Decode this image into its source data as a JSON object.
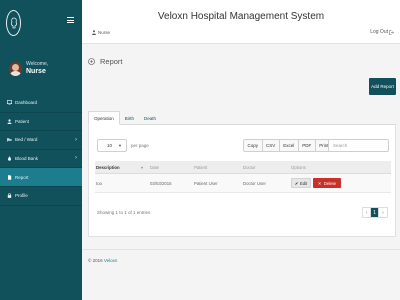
{
  "app": {
    "title": "Veloxn Hospital Management System"
  },
  "sidebar": {
    "profile": {
      "welcome": "Welcome,",
      "name": "Nurse"
    },
    "items": [
      {
        "label": "Dashboard",
        "icon": "dashboard-icon"
      },
      {
        "label": "Patient",
        "icon": "user-icon"
      },
      {
        "label": "Bed / Ward",
        "icon": "bed-icon",
        "has_children": true
      },
      {
        "label": "Blood Bank",
        "icon": "drop-icon",
        "has_children": true
      },
      {
        "label": "Report",
        "icon": "file-icon",
        "active": true
      },
      {
        "label": "Profile",
        "icon": "lock-icon"
      }
    ]
  },
  "header": {
    "user": "Nurse",
    "logout": "Log Out"
  },
  "page": {
    "title": "Report",
    "add_button": "Add Report",
    "tabs": [
      {
        "label": "Operation",
        "active": true
      },
      {
        "label": "Birth"
      },
      {
        "label": "Death"
      }
    ]
  },
  "table_controls": {
    "per_page_value": "10",
    "per_page_label": "per page",
    "exports": [
      "Copy",
      "CSV",
      "Excel",
      "PDF",
      "Print"
    ],
    "search_placeholder": "Search"
  },
  "table": {
    "columns": [
      "Description",
      "Date",
      "Patient",
      "Doctor",
      "Options"
    ],
    "rows": [
      {
        "description": "too",
        "date": "03/03/2015",
        "patient": "Patient User",
        "doctor": "Doctor User",
        "edit": "Edit",
        "delete": "Delete"
      }
    ]
  },
  "pagination": {
    "info": "Showing 1 to 1 of 1 entries",
    "prev": "‹",
    "current": "1",
    "next": "›"
  },
  "footer": {
    "copyright": "© 2016 ",
    "brand": "Veloxn"
  },
  "colors": {
    "sidebar": "#11515c",
    "active": "#1b7d8d",
    "danger": "#c9302c"
  }
}
